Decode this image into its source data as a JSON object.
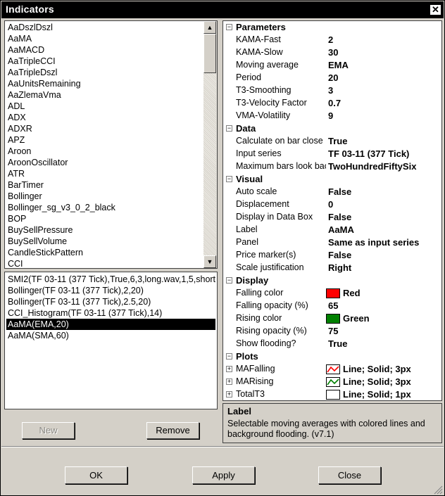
{
  "window": {
    "title": "Indicators",
    "close_glyph": "✕"
  },
  "indicator_list": [
    "AaDszlDszl",
    "AaMA",
    "AaMACD",
    "AaTripleCCI",
    "AaTripleDszl",
    "AaUnitsRemaining",
    "AaZlemaVma",
    "ADL",
    "ADX",
    "ADXR",
    "APZ",
    "Aroon",
    "AroonOscillator",
    "ATR",
    "BarTimer",
    "Bollinger",
    "Bollinger_sg_v3_0_2_black",
    "BOP",
    "BuySellPressure",
    "BuySellVolume",
    "CandleStickPattern",
    "CCI"
  ],
  "applied_list": {
    "items": [
      "SMI2(TF 03-11 (377 Tick),True,6,3,long.wav,1,5,short",
      "Bollinger(TF 03-11 (377 Tick),2,20)",
      "Bollinger(TF 03-11 (377 Tick),2.5,20)",
      "CCI_Histogram(TF 03-11 (377 Tick),14)",
      "AaMA(EMA,20)",
      "AaMA(SMA,60)"
    ],
    "selected_index": 4
  },
  "buttons": {
    "new": "New",
    "remove": "Remove",
    "ok": "OK",
    "apply": "Apply",
    "close": "Close"
  },
  "scroll_glyphs": {
    "up": "▲",
    "down": "▼"
  },
  "properties": {
    "collapse_glyph": "⊟",
    "expand_glyph": "+",
    "parameters": {
      "title": "Parameters",
      "rows": [
        {
          "label": "KAMA-Fast",
          "value": "2"
        },
        {
          "label": "KAMA-Slow",
          "value": "30"
        },
        {
          "label": "Moving average",
          "value": "EMA"
        },
        {
          "label": "Period",
          "value": "20"
        },
        {
          "label": "T3-Smoothing",
          "value": "3"
        },
        {
          "label": "T3-Velocity Factor",
          "value": "0.7"
        },
        {
          "label": "VMA-Volatility",
          "value": "9"
        }
      ]
    },
    "data": {
      "title": "Data",
      "rows": [
        {
          "label": "Calculate on bar close",
          "value": "True"
        },
        {
          "label": "Input series",
          "value": "TF 03-11 (377 Tick)"
        },
        {
          "label": "Maximum bars look back",
          "value": "TwoHundredFiftySix"
        }
      ]
    },
    "visual": {
      "title": "Visual",
      "rows": [
        {
          "label": "Auto scale",
          "value": "False"
        },
        {
          "label": "Displacement",
          "value": "0"
        },
        {
          "label": "Display in Data Box",
          "value": "False"
        },
        {
          "label": "Label",
          "value": "AaMA"
        },
        {
          "label": "Panel",
          "value": "Same as input series"
        },
        {
          "label": "Price marker(s)",
          "value": "False"
        },
        {
          "label": "Scale justification",
          "value": "Right"
        }
      ]
    },
    "display": {
      "title": "Display",
      "falling_color": {
        "label": "Falling color",
        "value": "Red",
        "color": "#ff0000"
      },
      "falling_opacity": {
        "label": "Falling opacity (%)",
        "value": "65"
      },
      "rising_color": {
        "label": "Rising color",
        "value": "Green",
        "color": "#008000"
      },
      "rising_opacity": {
        "label": "Rising opacity (%)",
        "value": "75"
      },
      "show_flooding": {
        "label": "Show flooding?",
        "value": "True"
      }
    },
    "plots": {
      "title": "Plots",
      "rows": [
        {
          "label": "MAFalling",
          "value": "Line; Solid; 3px",
          "color": "#ff0000",
          "icon": "line-plot-icon"
        },
        {
          "label": "MARising",
          "value": "Line; Solid; 3px",
          "color": "#008000",
          "icon": "line-plot-icon"
        },
        {
          "label": "TotalT3",
          "value": "Line; Solid; 1px",
          "color": "#ffffff",
          "icon": "empty-plot-icon"
        }
      ]
    }
  },
  "description": {
    "title": "Label",
    "text": "Selectable moving averages with colored lines and background flooding. (v7.1)"
  }
}
